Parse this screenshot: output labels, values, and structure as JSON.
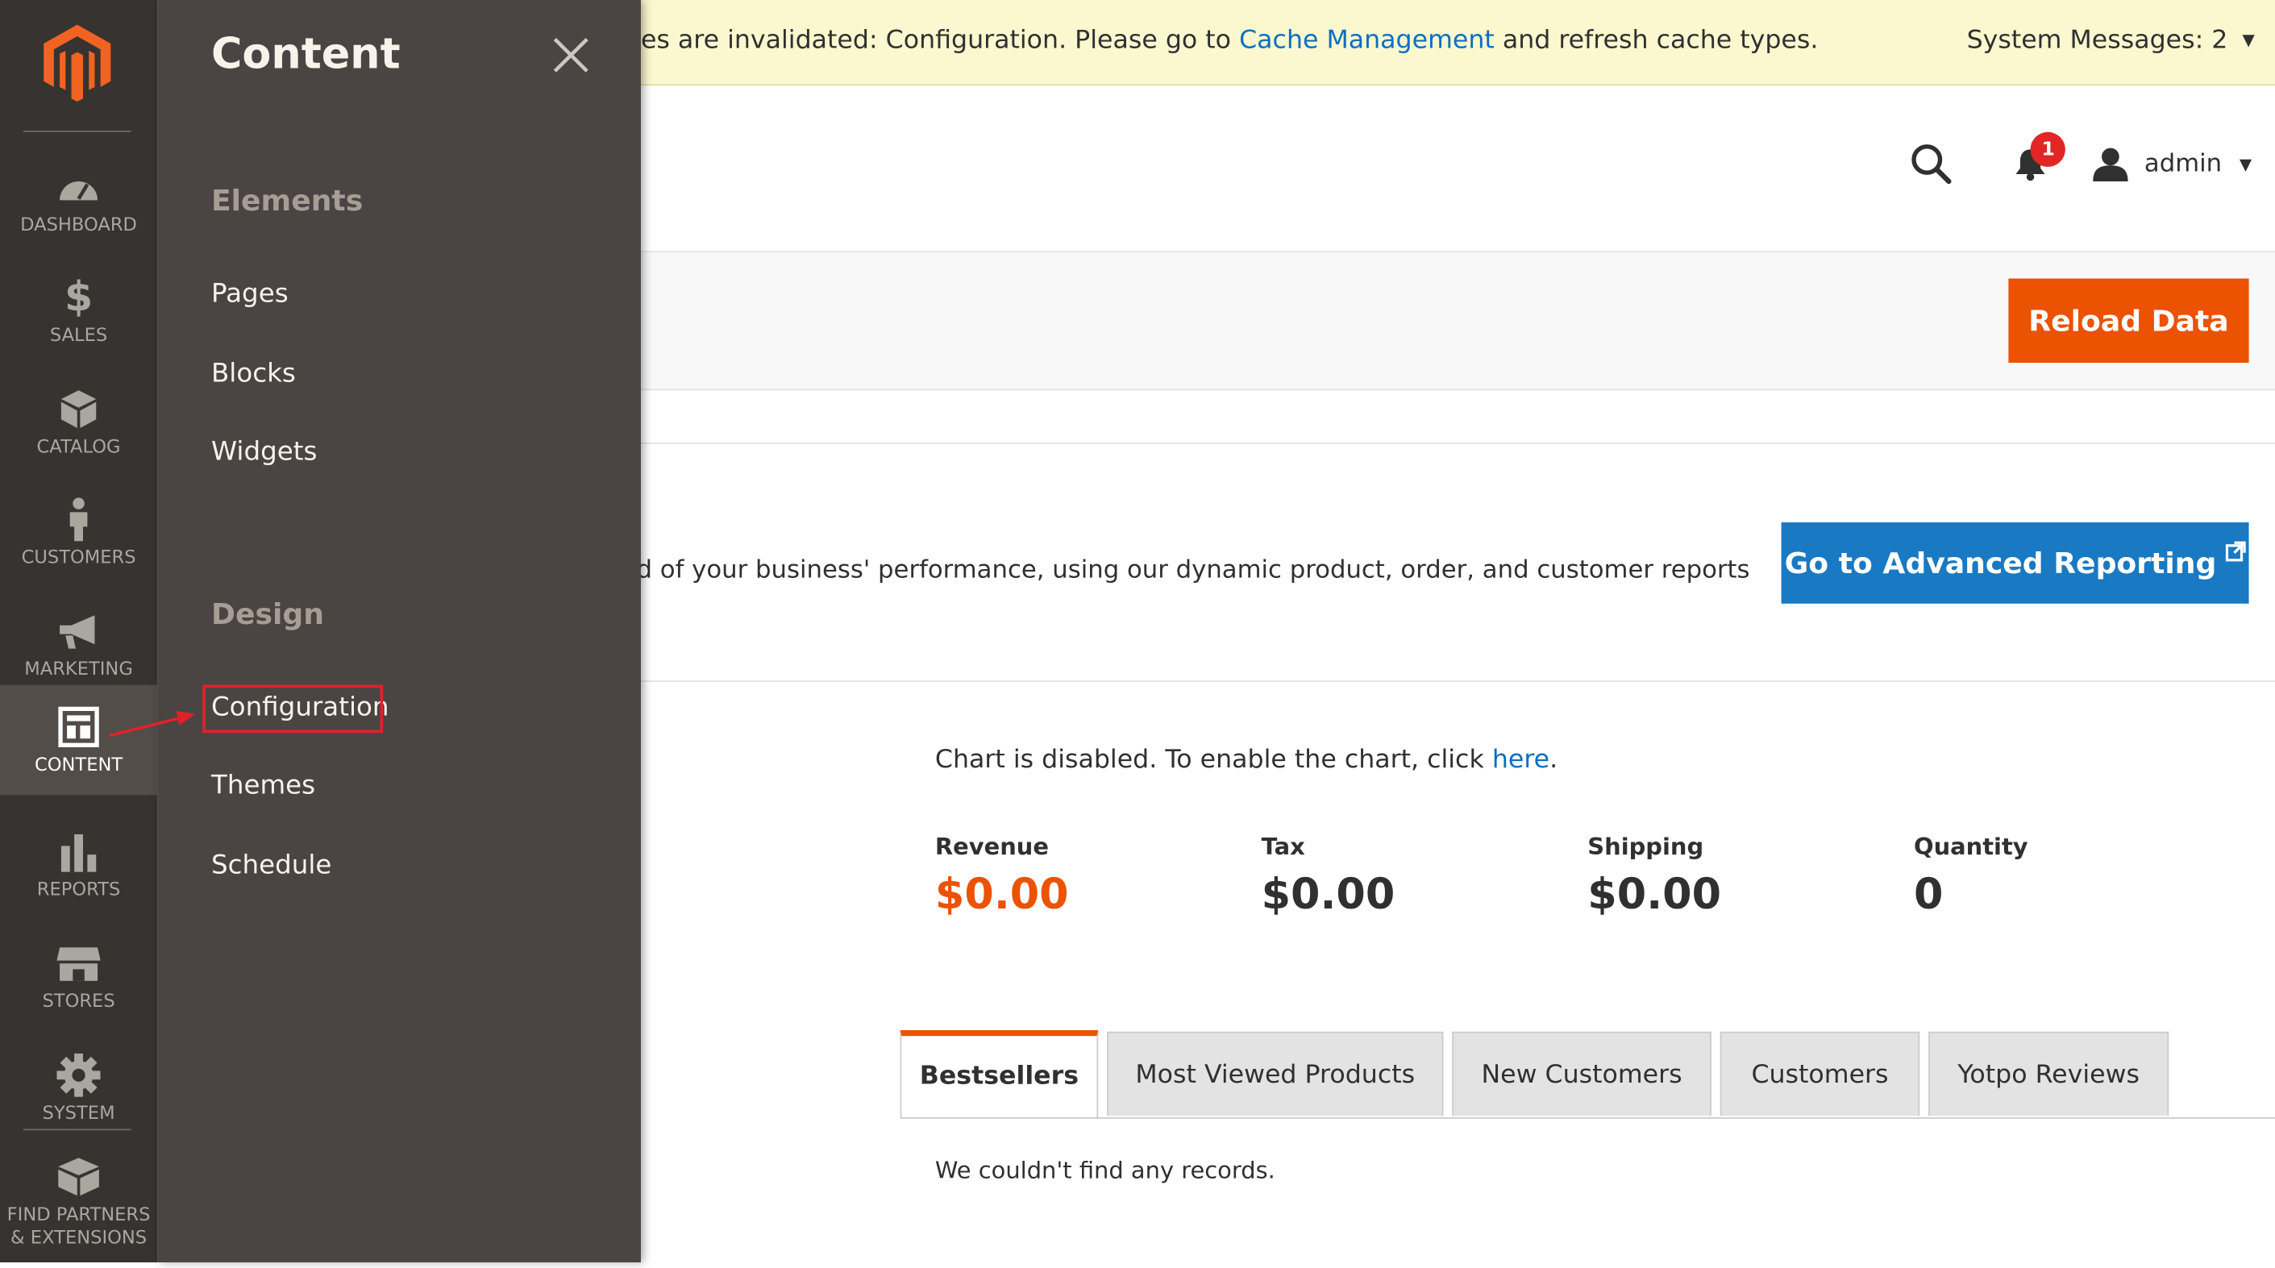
{
  "system_message": {
    "text_before": "es are invalidated: Configuration. Please go to",
    "link": "Cache Management",
    "text_after": "and refresh cache types.",
    "count_label": "System Messages: 2"
  },
  "header": {
    "notification_count": "1",
    "user_name": "admin"
  },
  "toolbar": {
    "reload_label": "Reload Data"
  },
  "advanced_reporting": {
    "text": "d of your business' performance, using our dynamic product, order, and customer reports",
    "button_label": "Go to Advanced Reporting",
    "button_icon": "external-link-icon"
  },
  "chart": {
    "disabled_text": "Chart is disabled. To enable the chart, click",
    "link": "here",
    "period": "."
  },
  "totals": [
    {
      "label": "Revenue",
      "value": "$0.00"
    },
    {
      "label": "Tax",
      "value": "$0.00"
    },
    {
      "label": "Shipping",
      "value": "$0.00"
    },
    {
      "label": "Quantity",
      "value": "0"
    }
  ],
  "tabs": [
    {
      "label": "Bestsellers",
      "active": true
    },
    {
      "label": "Most Viewed Products",
      "active": false
    },
    {
      "label": "New Customers",
      "active": false
    },
    {
      "label": "Customers",
      "active": false
    },
    {
      "label": "Yotpo Reviews",
      "active": false
    }
  ],
  "tab_content": {
    "empty_text": "We couldn't find any records."
  },
  "menu": {
    "items": [
      {
        "label": "DASHBOARD",
        "icon": "speedometer-icon"
      },
      {
        "label": "SALES",
        "icon": "dollar-icon"
      },
      {
        "label": "CATALOG",
        "icon": "cube-icon"
      },
      {
        "label": "CUSTOMERS",
        "icon": "person-icon"
      },
      {
        "label": "MARKETING",
        "icon": "megaphone-icon"
      },
      {
        "label": "CONTENT",
        "icon": "layout-icon",
        "active": true
      },
      {
        "label": "REPORTS",
        "icon": "bar-chart-icon"
      },
      {
        "label": "STORES",
        "icon": "storefront-icon"
      },
      {
        "label": "SYSTEM",
        "icon": "gear-icon"
      },
      {
        "label": "FIND PARTNERS & EXTENSIONS",
        "icon": "box-icon"
      }
    ]
  },
  "submenu": {
    "title": "Content",
    "groups": [
      {
        "title": "Elements",
        "links": [
          "Pages",
          "Blocks",
          "Widgets"
        ]
      },
      {
        "title": "Design",
        "links": [
          "Configuration",
          "Themes",
          "Schedule"
        ]
      }
    ]
  },
  "colors": {
    "accent_orange": "#eb5202",
    "accent_blue": "#1979c3",
    "link_blue": "#0a6fc1",
    "menubar_bg": "#373330",
    "submenu_bg": "#4a4542",
    "highlight_red": "#e3202a",
    "message_bg": "#fbf8d0"
  }
}
